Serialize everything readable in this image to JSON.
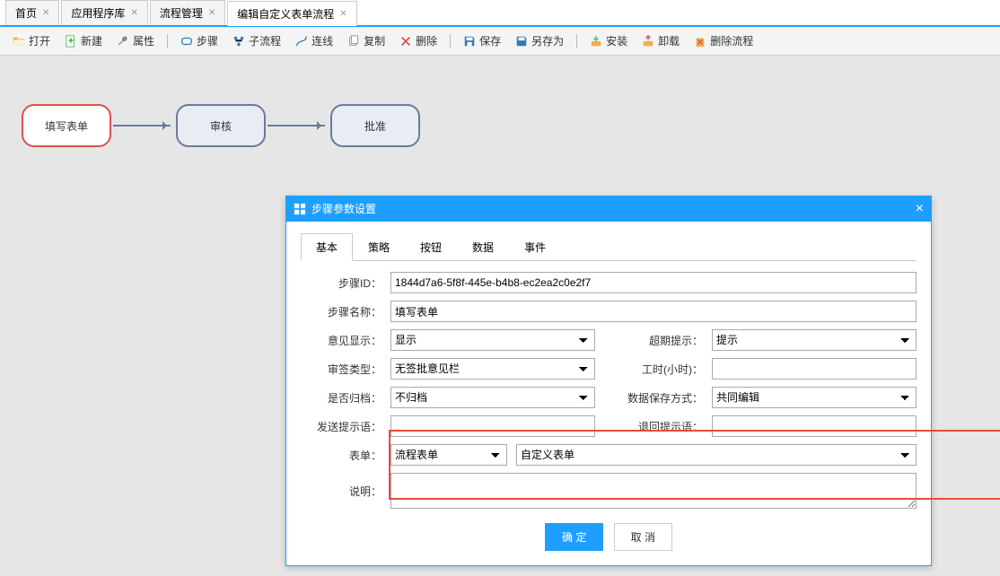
{
  "tabs": [
    {
      "label": "首页"
    },
    {
      "label": "应用程序库"
    },
    {
      "label": "流程管理"
    },
    {
      "label": "编辑自定义表单流程",
      "active": true
    }
  ],
  "toolbar": {
    "open": "打开",
    "new": "新建",
    "attr": "属性",
    "step": "步骤",
    "subflow": "子流程",
    "line": "连线",
    "copy": "复制",
    "delete": "删除",
    "save": "保存",
    "saveas": "另存为",
    "install": "安装",
    "uninstall": "卸载",
    "deleteflow": "删除流程"
  },
  "nodes": {
    "start": "填写表单",
    "n2": "审核",
    "n3": "批准"
  },
  "dialog": {
    "title": "步骤参数设置",
    "tabs": [
      "基本",
      "策略",
      "按钮",
      "数据",
      "事件"
    ],
    "labels": {
      "stepId": "步骤ID：",
      "stepName": "步骤名称：",
      "opinionShow": "意见显示：",
      "overdueTip": "超期提示：",
      "signType": "审签类型：",
      "workHour": "工时(小时)：",
      "archive": "是否归档：",
      "saveMode": "数据保存方式：",
      "sendTip": "发送提示语：",
      "backTip": "退回提示语：",
      "form": "表单：",
      "note": "说明："
    },
    "values": {
      "stepId": "1844d7a6-5f8f-445e-b4b8-ec2ea2c0e2f7",
      "stepName": "填写表单",
      "opinionShow": "显示",
      "overdueTip": "提示",
      "signType": "无签批意见栏",
      "workHour": "",
      "archive": "不归档",
      "saveMode": "共同编辑",
      "sendTip": "",
      "backTip": "",
      "formType": "流程表单",
      "formName": "自定义表单",
      "note": ""
    },
    "buttons": {
      "ok": "确 定",
      "cancel": "取 消"
    }
  }
}
